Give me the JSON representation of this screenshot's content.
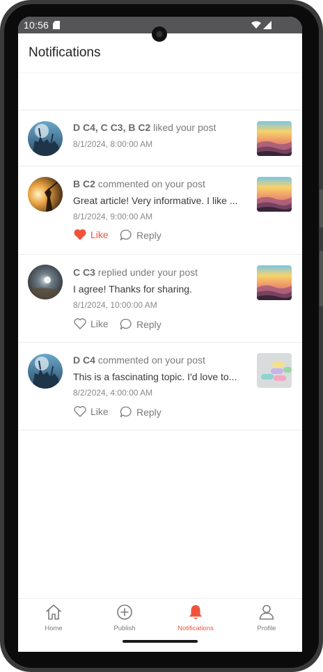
{
  "status_bar": {
    "time": "10:56"
  },
  "header": {
    "title": "Notifications"
  },
  "notifications": [
    {
      "actors": "D C4, C C3, B C2",
      "action_text": " liked your post",
      "preview": "",
      "time": "8/1/2024, 8:00:00 AM",
      "has_actions": false
    },
    {
      "actors": "B C2",
      "action_text": " commented on your post",
      "preview": "Great article! Very informative. I like ...",
      "time": "8/1/2024, 9:00:00 AM",
      "has_actions": true,
      "liked": true,
      "like_label": "Like",
      "reply_label": "Reply"
    },
    {
      "actors": "C C3",
      "action_text": " replied under your post",
      "preview": "I agree! Thanks for sharing.",
      "time": "8/1/2024, 10:00:00 AM",
      "has_actions": true,
      "liked": false,
      "like_label": "Like",
      "reply_label": "Reply"
    },
    {
      "actors": "D C4",
      "action_text": " commented on your post",
      "preview": "This is a fascinating topic. I'd love to...",
      "time": "8/2/2024, 4:00:00 AM",
      "has_actions": true,
      "liked": false,
      "like_label": "Like",
      "reply_label": "Reply"
    }
  ],
  "bottom_nav": {
    "items": [
      {
        "label": "Home",
        "icon": "home-icon",
        "active": false
      },
      {
        "label": "Publish",
        "icon": "plus-circle-icon",
        "active": false
      },
      {
        "label": "Notifications",
        "icon": "bell-icon",
        "active": true
      },
      {
        "label": "Profile",
        "icon": "person-icon",
        "active": false
      }
    ]
  },
  "colors": {
    "accent": "#f0533a",
    "text_muted": "#7a7a7a",
    "status_bar": "#555557"
  }
}
